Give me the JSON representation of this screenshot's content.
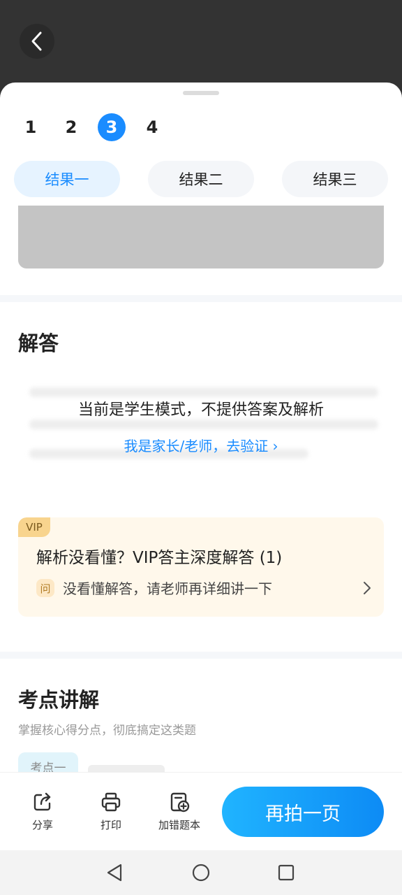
{
  "header": {
    "back_icon": "chevron-left-icon"
  },
  "pages": {
    "items": [
      "1",
      "2",
      "3",
      "4"
    ],
    "active": "3"
  },
  "results": {
    "tabs": [
      "结果一",
      "结果二",
      "结果三"
    ],
    "active": "结果一"
  },
  "answer": {
    "title": "解答",
    "notice": "当前是学生模式，不提供答案及解析",
    "verify_link": "我是家长/老师，去验证 ›"
  },
  "vip": {
    "badge": "VIP",
    "title": "解析没看懂？VIP答主深度解答 (1)",
    "ask_icon_label": "问",
    "subtitle": "没看懂解答，请老师再详细讲一下"
  },
  "knowledge": {
    "title": "考点讲解",
    "subtitle": "掌握核心得分点，彻底搞定这类题",
    "tag": "考点一"
  },
  "toolbar": {
    "share_label": "分享",
    "print_label": "打印",
    "add_wrong_label": "加错题本",
    "shoot_label": "再拍一页"
  },
  "colors": {
    "accent": "#1a8cff",
    "vip_bg": "#fff8eb",
    "vip_badge": "#f8d48e"
  }
}
